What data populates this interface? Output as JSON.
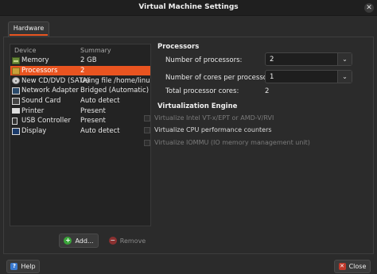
{
  "window": {
    "title": "Virtual Machine Settings"
  },
  "tabs": [
    {
      "label": "Hardware"
    }
  ],
  "device_list": {
    "headers": {
      "device": "Device",
      "summary": "Summary"
    },
    "rows": [
      {
        "icon": "memory-icon",
        "device": "Memory",
        "summary": "2 GB"
      },
      {
        "icon": "processor-icon",
        "device": "Processors",
        "summary": "2"
      },
      {
        "icon": "cd-dvd-icon",
        "device": "New CD/DVD (SATA)",
        "summary": "Using file /home/linuxte"
      },
      {
        "icon": "network-adapter-icon",
        "device": "Network Adapter",
        "summary": "Bridged (Automatic)"
      },
      {
        "icon": "sound-card-icon",
        "device": "Sound Card",
        "summary": "Auto detect"
      },
      {
        "icon": "printer-icon",
        "device": "Printer",
        "summary": "Present"
      },
      {
        "icon": "usb-icon",
        "device": "USB Controller",
        "summary": "Present"
      },
      {
        "icon": "display-icon",
        "device": "Display",
        "summary": "Auto detect"
      }
    ],
    "selected_index": 1
  },
  "device_buttons": {
    "add": "Add...",
    "remove": "Remove"
  },
  "processors": {
    "heading": "Processors",
    "num_processors_label": "Number of processors:",
    "num_processors_value": "2",
    "cores_label": "Number of cores per processor:",
    "cores_value": "1",
    "total_label": "Total processor cores:",
    "total_value": "2"
  },
  "virtualization": {
    "heading": "Virtualization Engine",
    "options": [
      {
        "label": "Virtualize Intel VT-x/EPT or AMD-V/RVI",
        "enabled": false,
        "checked": false
      },
      {
        "label": "Virtualize CPU performance counters",
        "enabled": true,
        "checked": false
      },
      {
        "label": "Virtualize IOMMU (IO memory management unit)",
        "enabled": false,
        "checked": false
      }
    ]
  },
  "footer": {
    "help": "Help",
    "close": "Close"
  },
  "colors": {
    "accent": "#e95420",
    "background": "#2b2b2b"
  }
}
